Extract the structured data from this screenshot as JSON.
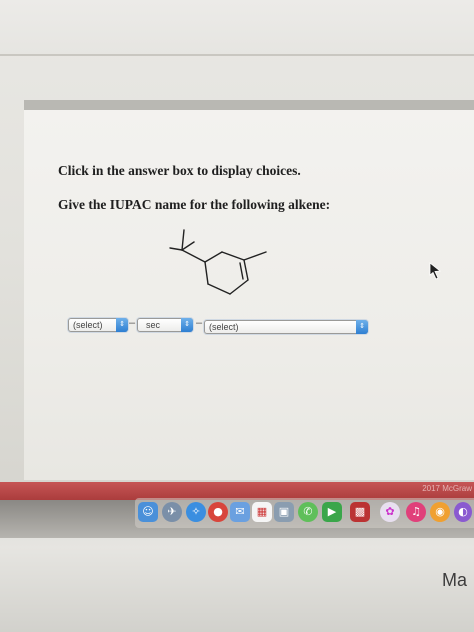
{
  "instructions": {
    "prompt": "Click in the answer box to display choices.",
    "question": "Give the IUPAC name for the following alkene:"
  },
  "answer": {
    "select_1": "(select)",
    "separator_1": "–",
    "middle_value": "sec",
    "separator_2": "–",
    "select_2": "(select)"
  },
  "watermark": "2017 McGraw",
  "brand": "Ma",
  "colors": {
    "stepper_blue": "#2e7fd2",
    "bottom_red": "#b84444"
  },
  "dock": {
    "icons": [
      "finder-icon",
      "launchpad-icon",
      "safari-icon",
      "chrome-icon",
      "mail-icon",
      "calendar-icon",
      "photos-icon",
      "messages-icon",
      "facetime-icon",
      "photo-booth-icon",
      "itunes-icon",
      "books-icon"
    ]
  }
}
